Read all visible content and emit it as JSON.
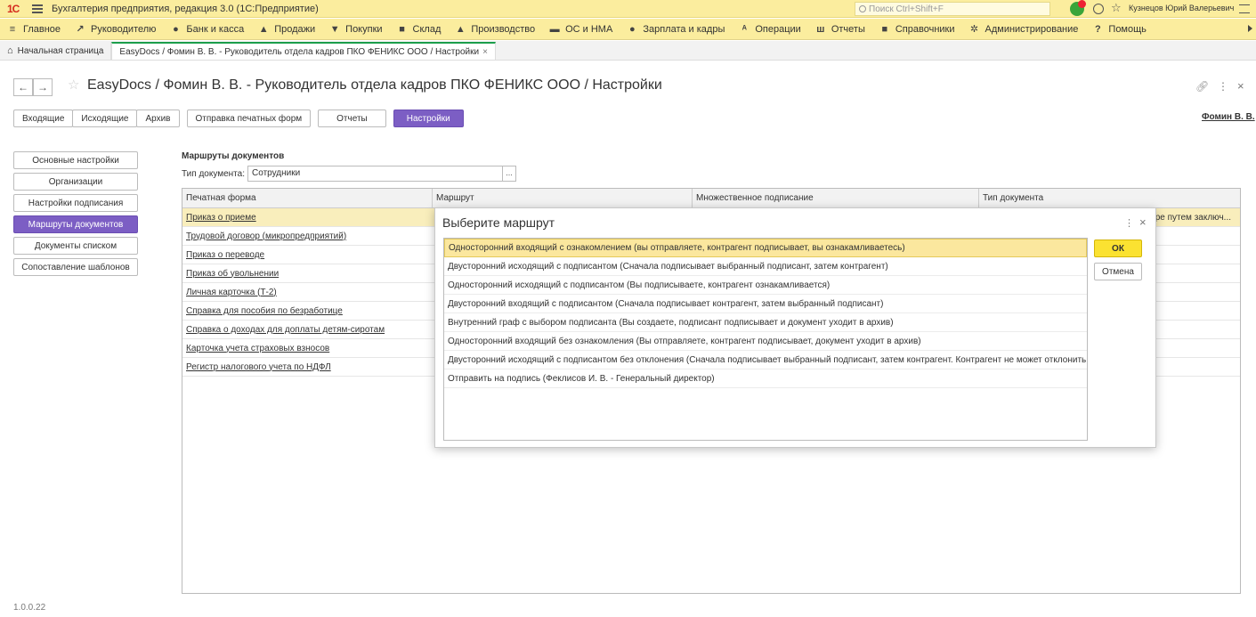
{
  "app": {
    "title": "Бухгалтерия предприятия, редакция 3.0  (1С:Предприятие)",
    "logo": "1С",
    "search_placeholder": "Поиск Ctrl+Shift+F",
    "user": "Кузнецов Юрий Валерьевич"
  },
  "sections": [
    {
      "icon": "≡",
      "label": "Главное"
    },
    {
      "icon": "↗",
      "label": "Руководителю"
    },
    {
      "icon": "●",
      "label": "Банк и касса"
    },
    {
      "icon": "▲",
      "label": "Продажи"
    },
    {
      "icon": "▼",
      "label": "Покупки"
    },
    {
      "icon": "■",
      "label": "Склад"
    },
    {
      "icon": "▲",
      "label": "Производство"
    },
    {
      "icon": "▬",
      "label": "ОС и НМА"
    },
    {
      "icon": "●",
      "label": "Зарплата и кадры"
    },
    {
      "icon": "ᴬ",
      "label": "Операции"
    },
    {
      "icon": "ш",
      "label": "Отчеты"
    },
    {
      "icon": "■",
      "label": "Справочники"
    },
    {
      "icon": "✲",
      "label": "Администрирование"
    },
    {
      "icon": "?",
      "label": "Помощь"
    }
  ],
  "open_tabs": {
    "home": "Начальная страница",
    "current": "EasyDocs / Фомин В. В. - Руководитель отдела кадров ПКО ФЕНИКС ООО / Настройки",
    "close": "×"
  },
  "form": {
    "back": "←",
    "forward": "→",
    "title": "EasyDocs / Фомин В. В. - Руководитель отдела кадров ПКО ФЕНИКС ООО / Настройки",
    "user_link": "Фомин В. В."
  },
  "top_buttons": {
    "incoming": "Входящие",
    "outgoing": "Исходящие",
    "archive": "Архив",
    "send_print_forms": "Отправка печатных форм",
    "reports": "Отчеты",
    "settings": "Настройки"
  },
  "left_menu": [
    {
      "label": "Основные настройки",
      "active": false
    },
    {
      "label": "Организации",
      "active": false
    },
    {
      "label": "Настройки подписания",
      "active": false
    },
    {
      "label": "Маршруты документов",
      "active": true
    },
    {
      "label": "Документы списком",
      "active": false
    },
    {
      "label": "Сопоставление шаблонов",
      "active": false
    }
  ],
  "routes": {
    "title": "Маршруты документов",
    "doctype_label": "Тип документа:",
    "doctype_value": "Сотрудники",
    "doctype_pick": "..."
  },
  "table": {
    "columns": [
      "Печатная форма",
      "Маршрут",
      "Множественное подписание",
      "Тип документа"
    ],
    "selected_doc_type_snippet": "ре путем заключ...",
    "rows": [
      "Приказ о приеме",
      "Трудовой договор (микропредприятий)",
      "Приказ о переводе",
      "Приказ об увольнении",
      "Личная карточка (Т-2)",
      "Справка для пособия по безработице",
      "Справка о доходах для доплаты детям-сиротам",
      "Карточка учета страховых взносов",
      "Регистр налогового учета по НДФЛ"
    ]
  },
  "dialog": {
    "title": "Выберите маршрут",
    "more": "⋮",
    "close": "×",
    "ok": "ОК",
    "cancel": "Отмена",
    "items": [
      "Односторонний входящий с ознакомлением (вы отправляете, контрагент подписывает, вы ознакамливаетесь)",
      "Двусторонний исходящий с подписантом (Сначала подписывает выбранный подписант, затем контрагент)",
      "Односторонний исходящий с подписантом (Вы подписываете, контрагент ознакамливается)",
      "Двусторонний входящий с подписантом (Сначала подписывает контрагент, затем выбранный подписант)",
      "Внутренний граф с выбором подписанта (Вы создаете, подписант подписывает и документ уходит в архив)",
      "Односторонний входящий без ознакомления (Вы отправляете, контрагент  подписывает, документ уходит в архив)",
      "Двусторонний исходящий с подписантом без отклонения (Сначала подписывает выбранный подписант, затем контрагент. Контрагент не может отклонить.)",
      "Отправить на подпись (Феклисов И. В. - Генеральный директор)"
    ]
  },
  "version": "1.0.0.22"
}
